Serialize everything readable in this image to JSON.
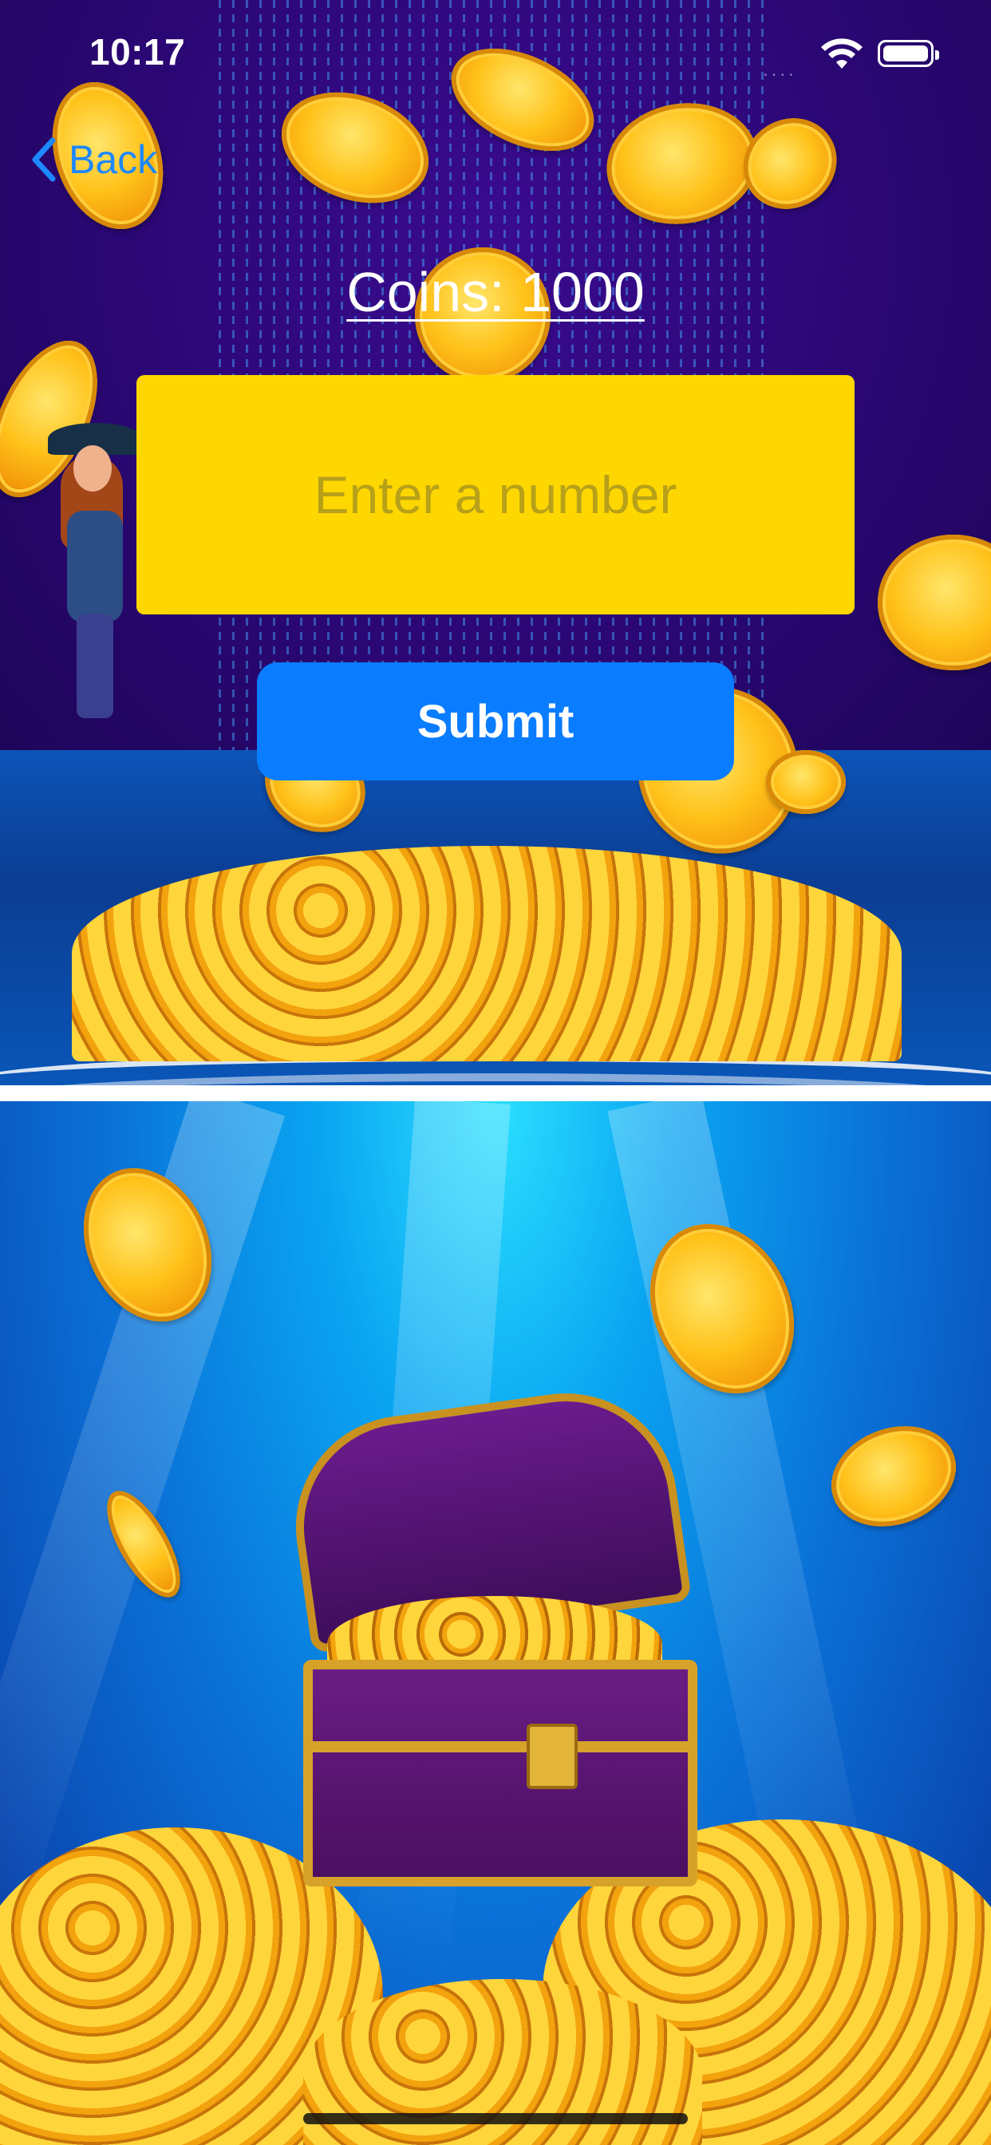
{
  "status_bar": {
    "time": "10:17",
    "signal_dots": "....",
    "wifi_icon": "wifi-icon",
    "battery_icon": "battery-icon"
  },
  "nav": {
    "back_label": "Back",
    "back_icon": "chevron-left-icon"
  },
  "main": {
    "coins_label": "Coins: 1000",
    "number_input": {
      "value": "",
      "placeholder": "Enter a number"
    },
    "submit_label": "Submit"
  },
  "colors": {
    "accent_blue": "#0A7CFF",
    "input_yellow": "#FFD700",
    "back_blue": "#1E88FF"
  },
  "background": {
    "scene": "treasure-sea-background"
  }
}
